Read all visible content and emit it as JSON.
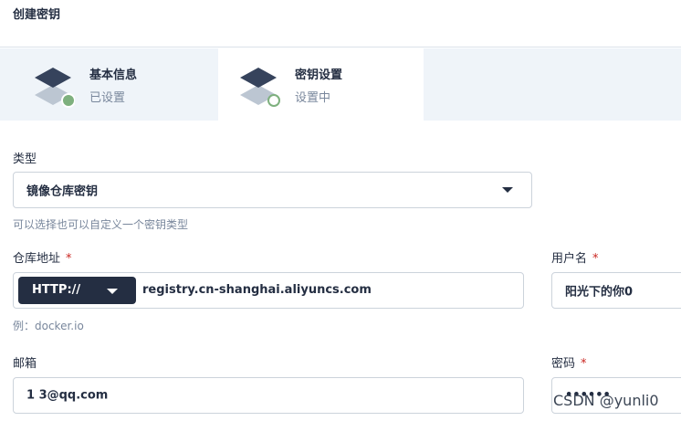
{
  "header": {
    "title": "创建密钥"
  },
  "steps": [
    {
      "title": "基本信息",
      "status": "已设置",
      "state": "done",
      "status_color": "#7eb07e"
    },
    {
      "title": "密钥设置",
      "status": "设置中",
      "state": "current",
      "status_color": "#7eb07e"
    }
  ],
  "form": {
    "type": {
      "label": "类型",
      "value": "镜像仓库密钥",
      "hint": "可以选择也可以自定义一个密钥类型"
    },
    "registry": {
      "label": "仓库地址",
      "required_mark": "*",
      "protocol": "HTTP://",
      "value": "registry.cn-shanghai.aliyuncs.com",
      "hint": "例：docker.io"
    },
    "username": {
      "label": "用户名",
      "required_mark": "*",
      "value": "阳光下的你0"
    },
    "email": {
      "label": "邮箱",
      "value": "1        3@qq.com"
    },
    "password": {
      "label": "密码",
      "required_mark": "*",
      "value": "••••••"
    }
  },
  "watermark": "CSDN @yunli0",
  "colors": {
    "dark": "#242e42",
    "step_bg": "#eff4f9",
    "required": "#ca2621",
    "done": "#7eb07e"
  }
}
